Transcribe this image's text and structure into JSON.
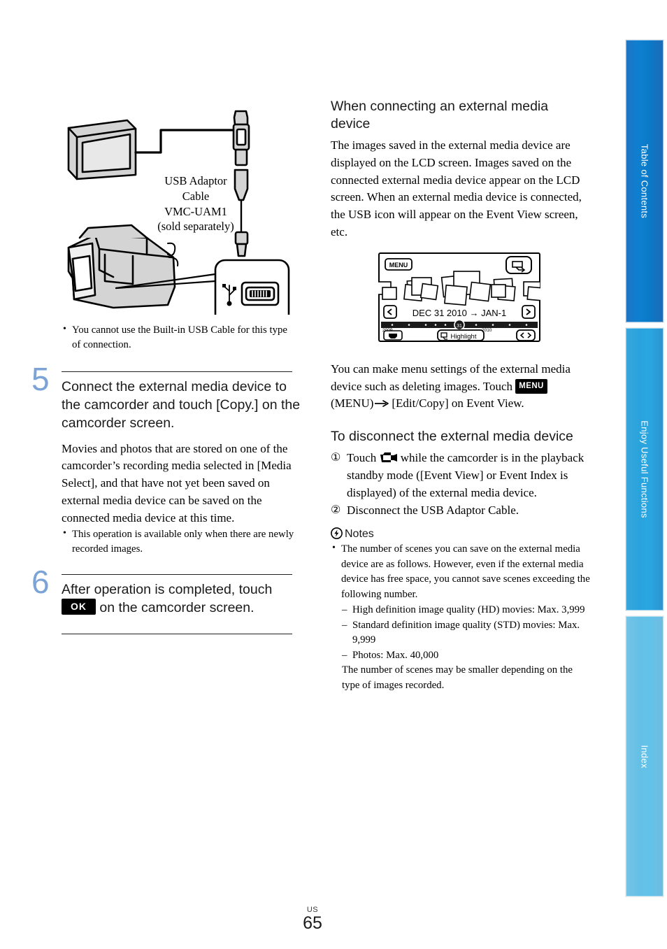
{
  "page": {
    "number": "65",
    "region_code": "US"
  },
  "side_tabs": [
    {
      "label": "Table of Contents",
      "color": "#0f7fd0"
    },
    {
      "label": "Enjoy Useful Functions",
      "color": "#2aa3dd"
    },
    {
      "label": "Index",
      "color": "#65c0e6"
    }
  ],
  "left_column": {
    "figure": {
      "name": "usb-adaptor-cable-connection-diagram",
      "caption_lines": [
        "USB Adaptor",
        "Cable",
        "VMC-UAM1",
        "(sold separately)"
      ],
      "usb_port_label": "USB"
    },
    "figure_notes": [
      "You cannot use the Built-in USB Cable for this type of connection."
    ],
    "steps": [
      {
        "number": "5",
        "heading": "Connect the external media device to the camcorder and touch [Copy.] on the camcorder screen.",
        "body": "Movies and photos that are stored on one of the camcorder’s recording media selected in [Media Select], and that have not yet been saved on external media device can be saved on the connected media device at this time.",
        "notes": [
          "This operation is available only when there are newly recorded images."
        ]
      },
      {
        "number": "6",
        "heading_before": "After operation is completed, touch",
        "heading_button": "OK",
        "heading_after": "on the camcorder screen.",
        "body": "",
        "notes": []
      }
    ]
  },
  "right_column": {
    "section1": {
      "heading": "When connecting an external media device",
      "paragraph": "The images saved in the external media device are displayed on the LCD screen. Images saved on the connected external media device appear on the LCD screen. When an external media device is connected, the USB icon will appear on the Event View screen, etc."
    },
    "lcd_figure": {
      "name": "event-view-screen",
      "menu_button": "MENU",
      "date_range": "DEC 31 2010 → JAN-1",
      "prev_arrow": "‹",
      "next_arrow": "›",
      "timeline_left_year": "2009",
      "timeline_right_year": "2010",
      "highlight_button": "Highlight"
    },
    "section2_paragraph_before": "You can make menu settings of the external media device such as deleting images. Touch",
    "section2_menu_button": "MENU",
    "section2_paragraph_mid": "(MENU)",
    "section2_paragraph_after": "[Edit/Copy] on Event View.",
    "section3": {
      "heading": "To disconnect the external media device",
      "items": [
        {
          "marker": "①",
          "text_before": "Touch",
          "has_icon": true,
          "icon_name": "camcorder-icon",
          "text_after": "while the camcorder is in the playback standby mode ([Event View] or Event Index is displayed) of the external media device."
        },
        {
          "marker": "②",
          "text_before": "Disconnect the USB Adaptor Cable.",
          "has_icon": false,
          "icon_name": "",
          "text_after": ""
        }
      ]
    },
    "notes": {
      "heading": "Notes",
      "bullets": [
        "The number of scenes you can save on the external media device are as follows. However, even if the external media device has free space, you cannot save scenes exceeding the following number."
      ],
      "sub_items": [
        "High definition image quality (HD) movies: Max. 3,999",
        "Standard definition image quality (STD) movies: Max. 9,999",
        "Photos: Max. 40,000"
      ],
      "closing": "The number of scenes may be smaller depending on the type of images recorded."
    }
  }
}
